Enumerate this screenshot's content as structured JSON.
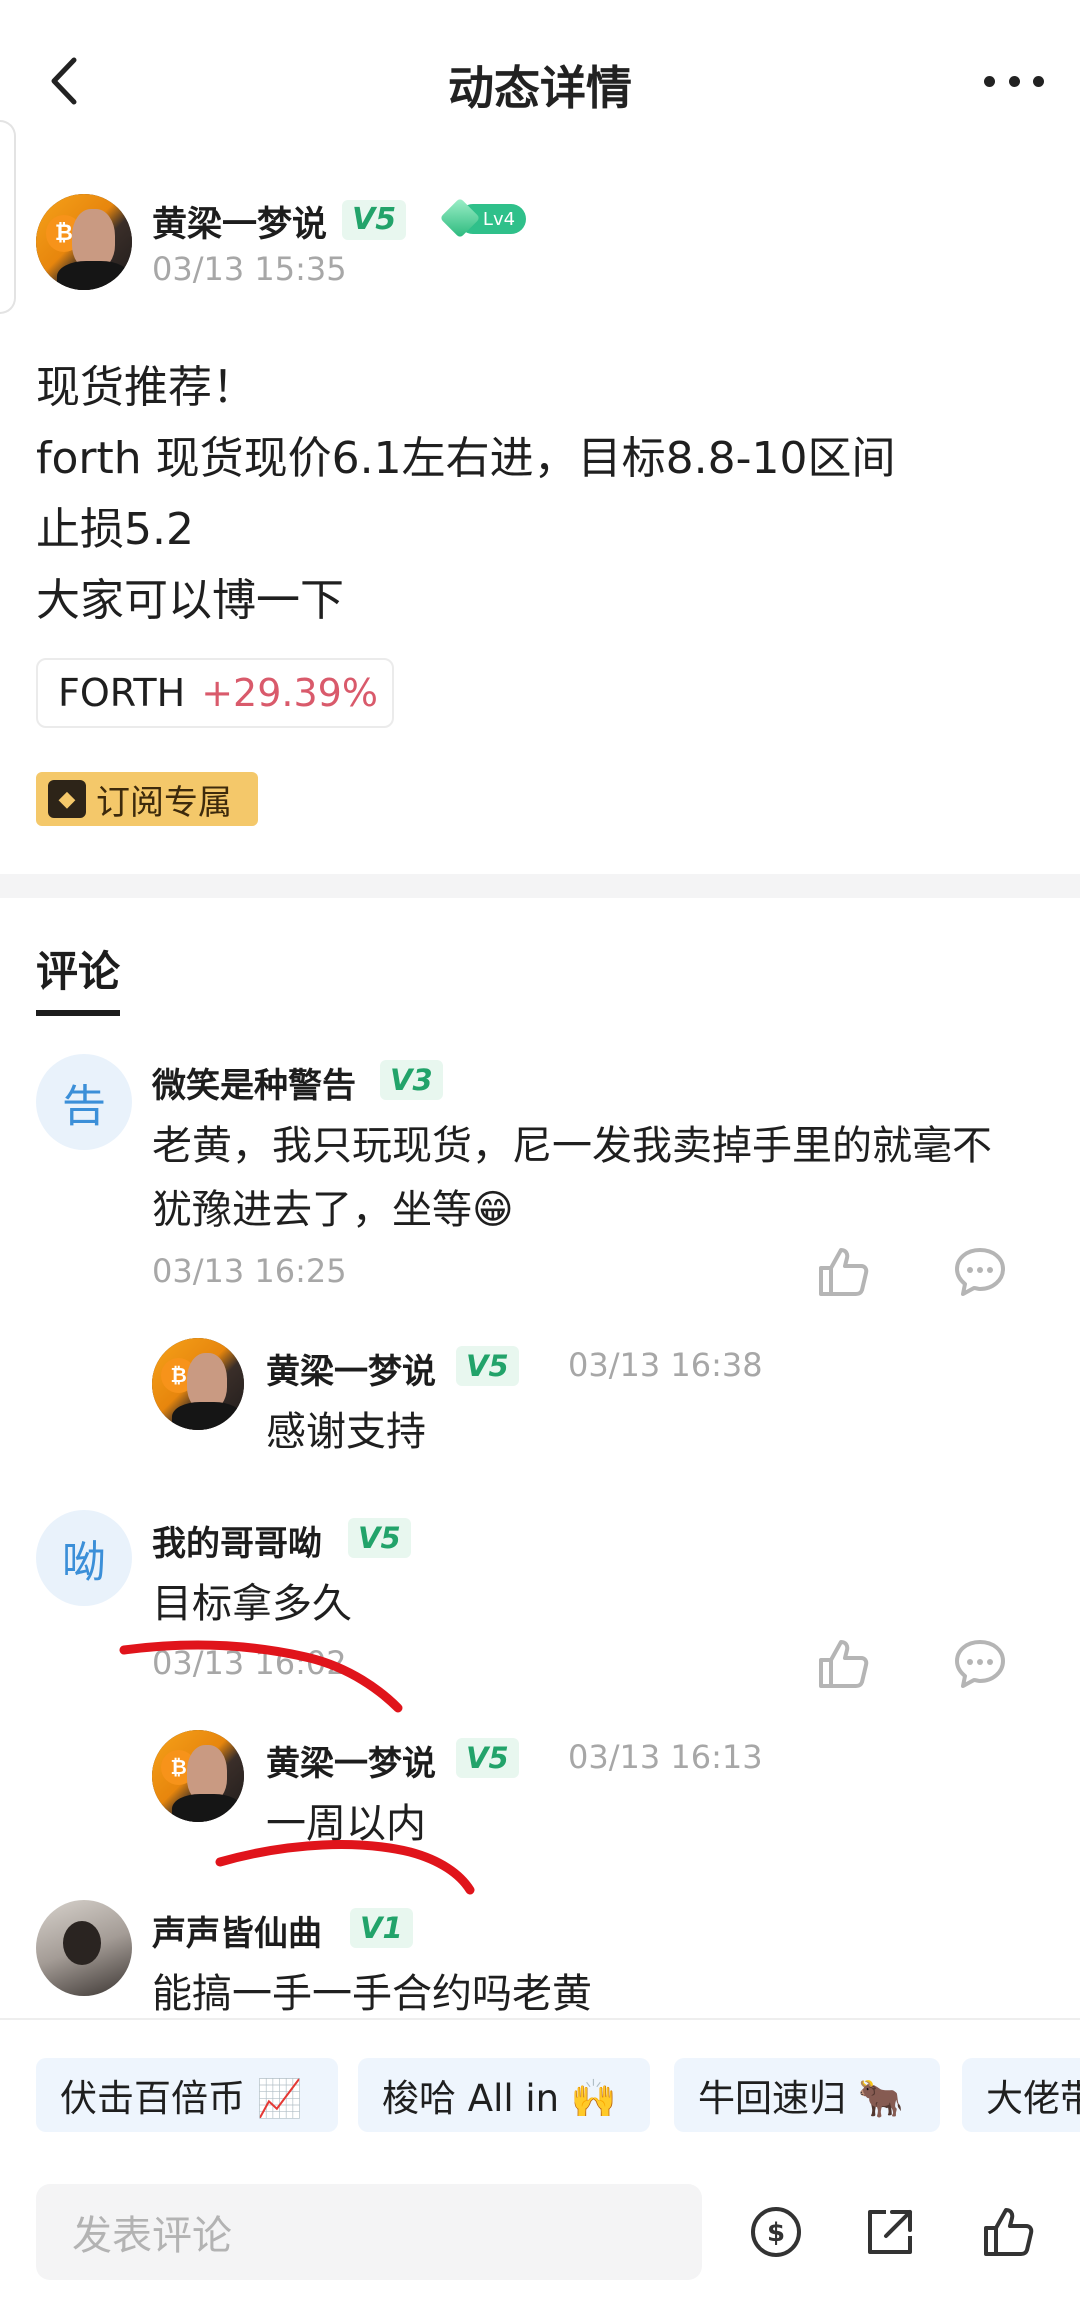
{
  "header": {
    "title": "动态详情"
  },
  "post": {
    "author": {
      "name": "黄梁一梦说",
      "vip": "V5",
      "level": "Lv4"
    },
    "time": "03/13 15:35",
    "lines": [
      "现货推荐！",
      "forth 现货现价6.1左右进，目标8.8-10区间",
      "止损5.2",
      "大家可以博一下"
    ],
    "coin_tag": {
      "symbol": "FORTH",
      "change": "+29.39%"
    },
    "subscription_tag": "订阅专属"
  },
  "comments_tab": "评论",
  "comments": [
    {
      "avatar_char": "告",
      "name": "微笑是种警告",
      "vip": "V3",
      "text_lines": [
        "老黄，我只玩现货，尼一发我卖掉手里的就毫不",
        "犹豫进去了，坐等😁"
      ],
      "time": "03/13 16:25",
      "reply": {
        "name": "黄梁一梦说",
        "vip": "V5",
        "time": "03/13 16:38",
        "text": "感谢支持"
      }
    },
    {
      "avatar_char": "呦",
      "name": "我的哥哥呦",
      "vip": "V5",
      "text_lines": [
        "目标拿多久"
      ],
      "time": "03/13 16:02",
      "reply": {
        "name": "黄梁一梦说",
        "vip": "V5",
        "time": "03/13 16:13",
        "text": "一周以内"
      }
    },
    {
      "name": "声声皆仙曲",
      "vip": "V1",
      "text_lines": [
        "能搞一手一手合约吗老黄"
      ]
    }
  ],
  "quick_replies": [
    "伏击百倍币 📈",
    "梭哈 All in 🙌",
    "牛回速归 🐂",
    "大佬带"
  ],
  "input": {
    "placeholder": "发表评论"
  },
  "colors": {
    "accent_green": "#22a36a",
    "price_up": "#d95a6b",
    "chip_bg": "#eef5fd",
    "subscription_gold": "#f4c86a",
    "scribble_red": "#e0141b"
  },
  "icons": [
    "back-arrow-icon",
    "more-dots-icon",
    "thumbs-up-icon",
    "comment-bubble-icon",
    "coin-icon",
    "share-icon",
    "diamond-icon"
  ]
}
